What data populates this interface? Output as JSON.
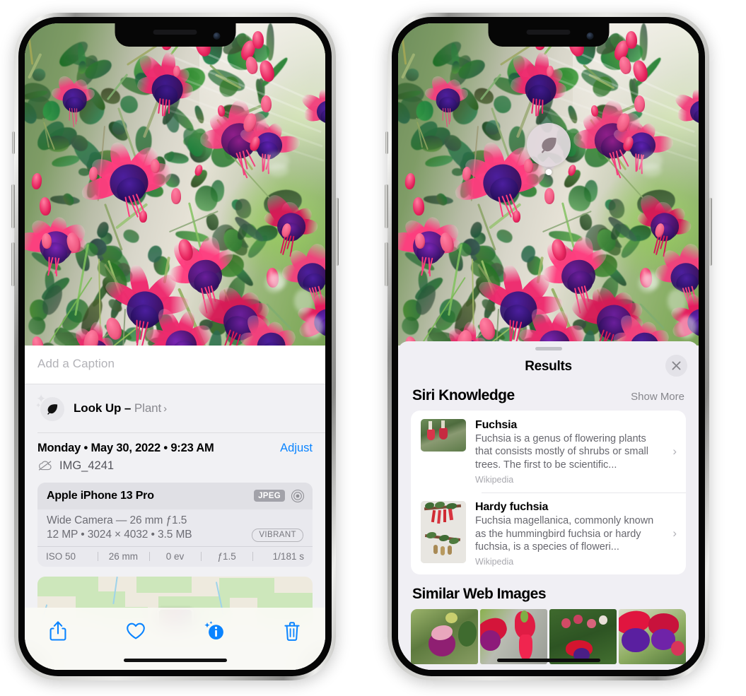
{
  "colors": {
    "accent_blue": "#0a84ff",
    "sheet_bg": "#f1f1f4",
    "results_bg": "#f0eff4",
    "card_bg": "#ffffff",
    "secondary_text": "#8a8a90",
    "badge_gray": "#a2a2a9"
  },
  "left_phone": {
    "name": "photos-detail-screen",
    "caption": {
      "placeholder": "Add a Caption",
      "value": ""
    },
    "look_up": {
      "label": "Look Up –",
      "subject": "Plant",
      "chevron": "›",
      "icon": "leaf-icon"
    },
    "meta": {
      "date": "Monday • May 30, 2022 • 9:23 AM",
      "adjust_label": "Adjust",
      "filename": "IMG_4241",
      "cloud_icon": "icloud-slash-icon"
    },
    "camera_card": {
      "model": "Apple iPhone 13 Pro",
      "format_badge": "JPEG",
      "raw_icon": "aperture-circles-icon",
      "lens_line": "Wide Camera — 26 mm ƒ1.5",
      "size_line": "12 MP • 3024 × 4032 • 3.5 MB",
      "style_badge": "VIBRANT",
      "exif": [
        "ISO 50",
        "26 mm",
        "0 ev",
        "ƒ1.5",
        "1/181 s"
      ]
    },
    "toolbar": [
      {
        "name": "share-button",
        "icon": "share-icon"
      },
      {
        "name": "favorite-button",
        "icon": "heart-icon"
      },
      {
        "name": "info-button",
        "icon": "info-sparkle-icon"
      },
      {
        "name": "delete-button",
        "icon": "trash-icon"
      }
    ]
  },
  "right_phone": {
    "name": "visual-look-up-results-screen",
    "badge": {
      "icon": "leaf-icon",
      "name": "visual-look-up-badge"
    },
    "sheet": {
      "title": "Results",
      "close_icon": "close-icon"
    },
    "siri_knowledge": {
      "title": "Siri Knowledge",
      "show_more": "Show More",
      "items": [
        {
          "title": "Fuchsia",
          "description": "Fuchsia is a genus of flowering plants that consists mostly of shrubs or small trees. The first to be scientific...",
          "source": "Wikipedia",
          "thumb": "fuchsia-red-flowers-thumbnail"
        },
        {
          "title": "Hardy fuchsia",
          "description": "Fuchsia magellanica, commonly known as the hummingbird fuchsia or hardy fuchsia, is a species of floweri...",
          "source": "Wikipedia",
          "thumb": "hardy-fuchsia-specimen-thumbnail"
        }
      ]
    },
    "similar_web_images": {
      "title": "Similar Web Images",
      "images": [
        "fuchsia-pink-white-bloom",
        "fuchsia-red-magenta-closeup",
        "fuchsia-bush-with-buds",
        "fuchsia-purple-magenta-pair"
      ]
    }
  }
}
